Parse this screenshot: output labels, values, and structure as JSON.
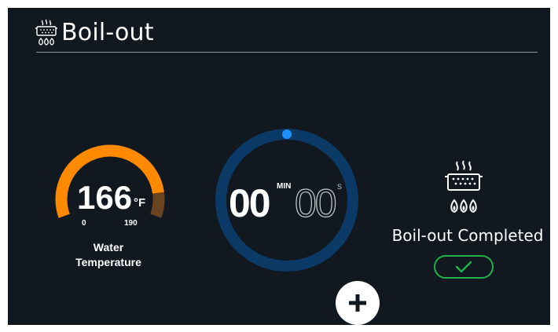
{
  "header": {
    "title": "Boil-out",
    "icon": "boil-icon"
  },
  "water_gauge": {
    "value": "166",
    "unit": "°F",
    "min": "0",
    "max": "190",
    "label_line1": "Water",
    "label_line2": "Temperature",
    "value_numeric": 166,
    "min_numeric": 0,
    "max_numeric": 190,
    "fill_color": "#ff8a00",
    "track_color": "#6a4320"
  },
  "timer": {
    "minutes": "00",
    "minutes_label": "MIN",
    "seconds": "00",
    "seconds_label": "S",
    "ring_color": "#0c3a66",
    "indicator_color": "#1e90ff"
  },
  "actions": {
    "plus_icon": "plus-icon"
  },
  "status": {
    "icon": "boil-icon",
    "label": "Boil-out Completed",
    "check_icon": "check-icon",
    "check_color": "#21b14a"
  },
  "colors": {
    "background": "#111820",
    "text": "#ffffff"
  }
}
